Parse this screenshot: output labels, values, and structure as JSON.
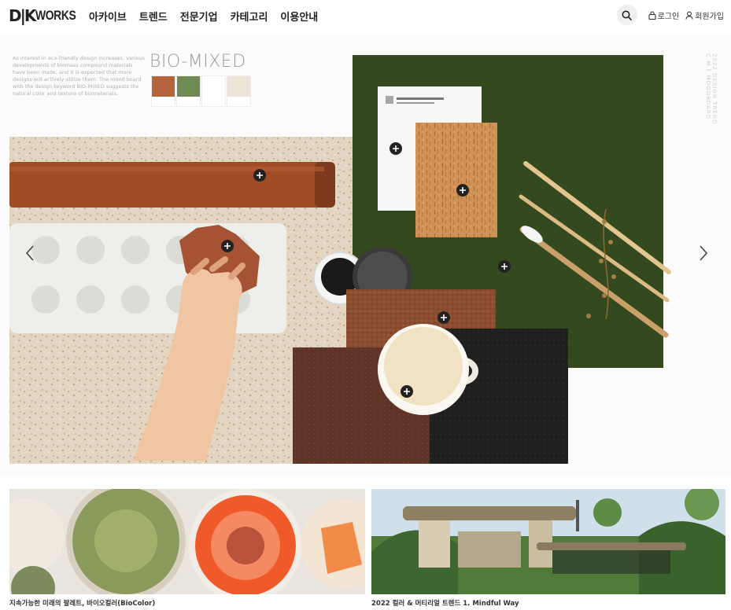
{
  "header": {
    "logo_mark": "D|K",
    "logo_text": "WORKS",
    "nav": [
      "아카이브",
      "트렌드",
      "전문기업",
      "카테고리",
      "이용안내"
    ],
    "login_label": "로그인",
    "signup_label": "회원가입"
  },
  "hero": {
    "title": "BIO-MIXED",
    "intro": "As interest in eco-friendly design increases, various developments of biomass compound materials have been made, and it is expected that more designs will actively utilize them. The mood board with the design keyword BIO-MIXED suggests the natural color and texture of biomaterials.",
    "side_text": "2022 DESIGN TREND C.M.F MOODBOARD",
    "swatch_colors": [
      "#b4633c",
      "#6f8a55",
      "#ffffff",
      "#ede3d6"
    ],
    "prev_icon": "chevron-left-icon",
    "next_icon": "chevron-right-icon",
    "hotspot_icon": "plus-icon"
  },
  "cards": [
    {
      "caption": "지속가능한 미래의 팔레트, 바이오컬러(BioColor)"
    },
    {
      "caption": "2022 컬러 & 머티리얼 트렌드 1. Mindful Way"
    }
  ],
  "colors": {
    "accent_text": "#222222",
    "green_board": "#344a1e",
    "cork": "#c98a4d",
    "leather": "#a04d26"
  }
}
